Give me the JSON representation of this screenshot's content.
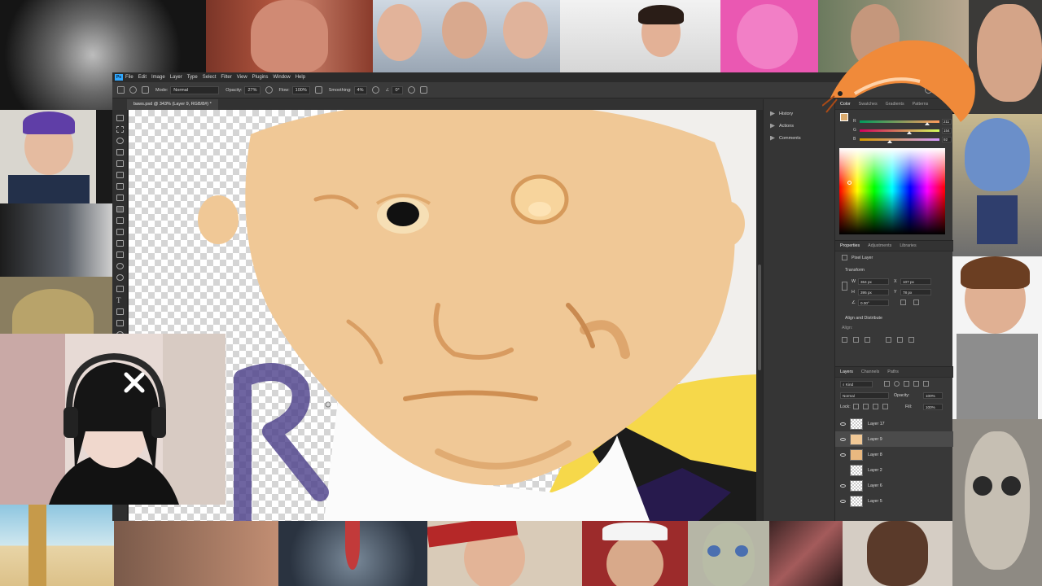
{
  "app": {
    "logo": "Ps",
    "menu": [
      "File",
      "Edit",
      "Image",
      "Layer",
      "Type",
      "Select",
      "Filter",
      "View",
      "Plugins",
      "Window",
      "Help"
    ]
  },
  "options_bar": {
    "mode_label": "Mode:",
    "mode_value": "Normal",
    "opacity_label": "Opacity:",
    "opacity_value": "27%",
    "flow_label": "Flow:",
    "flow_value": "100%",
    "smoothing_label": "Smoothing:",
    "smoothing_value": "4%",
    "angle_value": "0°"
  },
  "document": {
    "tab_title": "baws.psd @ 343% (Layer 9, RGB/8#) *"
  },
  "history_panel": {
    "items": [
      "History",
      "Actions",
      "Comments"
    ]
  },
  "color_panel": {
    "tabs": [
      "Color",
      "Swatches",
      "Gradients",
      "Patterns"
    ],
    "foreground": "#dbab6e",
    "r": "211",
    "g": "154",
    "b": "92"
  },
  "properties_panel": {
    "tabs": [
      "Properties",
      "Adjustments",
      "Libraries"
    ],
    "layer_kind": "Pixel Layer",
    "transform_label": "Transform",
    "w_label": "W",
    "w_value": "364 px",
    "h_label": "H",
    "h_value": "395 px",
    "x_label": "X",
    "x_value": "107 px",
    "y_label": "Y",
    "y_value": "78 px",
    "angle_value": "0.00°",
    "align_label": "Align and Distribute",
    "align_sub": "Align:"
  },
  "layers_panel": {
    "tabs": [
      "Layers",
      "Channels",
      "Paths"
    ],
    "filter_kind": "Kind",
    "blend_mode": "Normal",
    "opacity_label": "Opacity:",
    "opacity_value": "100%",
    "lock_label": "Lock:",
    "fill_label": "Fill:",
    "fill_value": "100%",
    "layers": [
      {
        "name": "Layer 17",
        "visible": true,
        "selected": false
      },
      {
        "name": "Layer 9",
        "visible": true,
        "selected": true
      },
      {
        "name": "Layer 8",
        "visible": true,
        "selected": false
      },
      {
        "name": "Layer 2",
        "visible": false,
        "selected": false
      },
      {
        "name": "Layer 6",
        "visible": true,
        "selected": false
      },
      {
        "name": "Layer 5",
        "visible": true,
        "selected": false
      }
    ]
  },
  "colors": {
    "ps_accent": "#31a8ff",
    "skin": "#f0c896",
    "yellow": "#f6d84a"
  }
}
